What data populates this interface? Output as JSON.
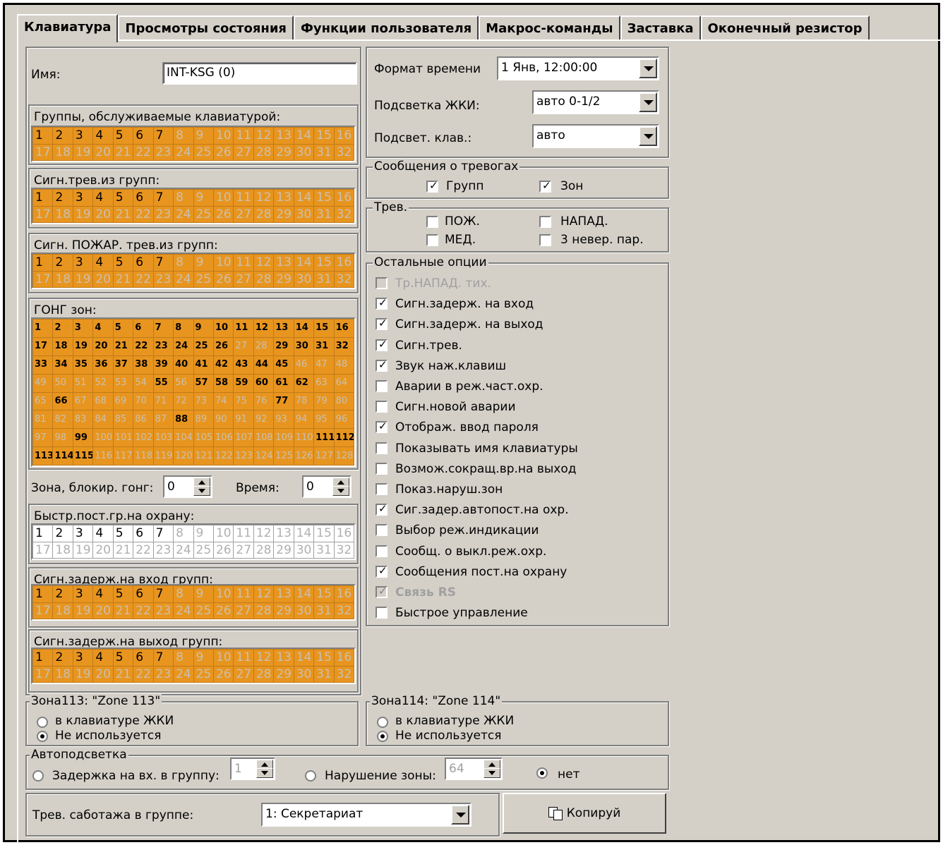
{
  "tabs": [
    "Клавиатура",
    "Просмотры состояния",
    "Функции пользователя",
    "Макрос-команды",
    "Заставка",
    "Оконечный резистор"
  ],
  "name": {
    "label": "Имя:",
    "value": "INT-KSG    (0)"
  },
  "groups_served": {
    "title": "Группы, обслуживаемые клавиатурой:"
  },
  "alarm_groups": {
    "title": "Сигн.трев.из групп:"
  },
  "fire_groups": {
    "title": "Сигн. ПОЖАР. трев.из групп:"
  },
  "gong": {
    "title": "ГОНГ зон:",
    "active": [
      1,
      2,
      3,
      4,
      5,
      6,
      7,
      8,
      9,
      10,
      11,
      12,
      13,
      14,
      15,
      16,
      17,
      18,
      19,
      20,
      21,
      22,
      23,
      24,
      25,
      26,
      29,
      30,
      31,
      32,
      33,
      34,
      35,
      36,
      37,
      38,
      39,
      40,
      41,
      42,
      43,
      44,
      45,
      55,
      57,
      58,
      59,
      60,
      61,
      62,
      66,
      77,
      88,
      99,
      111,
      112,
      113,
      114,
      115
    ]
  },
  "gong_block": {
    "label": "Зона, блокир. гонг:",
    "value": "0",
    "time_label": "Время:",
    "time_value": "0"
  },
  "quick_arm": {
    "title": "Быстр.пост.гр.на охрану:"
  },
  "entry_delay": {
    "title": "Сигн.задерж.на вход групп:"
  },
  "exit_delay": {
    "title": "Сигн.задерж.на выход групп:"
  },
  "active_groups": [
    1,
    2,
    3,
    4,
    5,
    6,
    7
  ],
  "time_format": {
    "label": "Формат времени",
    "value": "1 Янв, 12:00:00"
  },
  "lcd_backlight": {
    "label": "Подсветка ЖКИ:",
    "value": "авто 0-1/2"
  },
  "key_backlight": {
    "label": "Подсвет. клав.:",
    "value": "авто"
  },
  "alarm_msgs": {
    "title": "Сообщения о тревогах",
    "groups": "Групп",
    "zones": "Зон"
  },
  "trev": {
    "title": "Трев.",
    "fire": "ПОЖ.",
    "attack": "НАПАД.",
    "med": "МЕД.",
    "wrong_pass": "3 невер. пар."
  },
  "options": {
    "title": "Остальные опции",
    "items": [
      {
        "label": "Тр.НАПАД. тих.",
        "checked": false,
        "disabled": true
      },
      {
        "label": "Сигн.задерж. на вход",
        "checked": true
      },
      {
        "label": "Сигн.задерж. на выход",
        "checked": true
      },
      {
        "label": "Сигн.трев.",
        "checked": true
      },
      {
        "label": "Звук наж.клавиш",
        "checked": true
      },
      {
        "label": "Аварии в реж.част.охр.",
        "checked": false
      },
      {
        "label": "Сигн.новой аварии",
        "checked": false
      },
      {
        "label": "Отображ. ввод пароля",
        "checked": true
      },
      {
        "label": "Показывать имя клавиатуры",
        "checked": false
      },
      {
        "label": "Возмож.сокращ.вр.на выход",
        "checked": false
      },
      {
        "label": "Показ.наруш.зон",
        "checked": false
      },
      {
        "label": "Сиг.задер.автопост.на охр.",
        "checked": true
      },
      {
        "label": "Выбор реж.индикации",
        "checked": false
      },
      {
        "label": "Сообщ. о выкл.реж.охр.",
        "checked": false
      },
      {
        "label": "Сообщения пост.на охрану",
        "checked": true
      },
      {
        "label": "Связь RS",
        "checked": true,
        "disabled": true,
        "bold": true
      },
      {
        "label": "Быстрое управление",
        "checked": false
      }
    ]
  },
  "zone113": {
    "title": "Зона113: \"Zone 113\"",
    "opt1": "в клавиатуре ЖКИ",
    "opt2": "Не используется"
  },
  "zone114": {
    "title": "Зона114: \"Zone 114\"",
    "opt1": "в клавиатуре ЖКИ",
    "opt2": "Не используется"
  },
  "autolight": {
    "title": "Автоподсветка",
    "delay": "Задержка на вх. в группу:",
    "delay_value": "1",
    "violation": "Нарушение зоны:",
    "violation_value": "64",
    "none": "нет"
  },
  "tamper": {
    "label": "Трев. саботажа в группе:",
    "value": "1: Секретариат"
  },
  "copy_button": "Копируй"
}
